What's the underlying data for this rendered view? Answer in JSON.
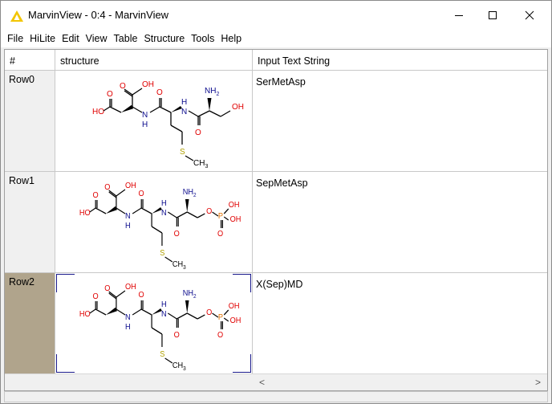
{
  "window": {
    "title": "MarvinView - 0:4 - MarvinView"
  },
  "menu": [
    "File",
    "HiLite",
    "Edit",
    "View",
    "Table",
    "Structure",
    "Tools",
    "Help"
  ],
  "columns": {
    "num": "#",
    "structure": "structure",
    "text": "Input Text String"
  },
  "rows": [
    {
      "id": "Row0",
      "text": "SerMetAsp",
      "selected": false,
      "phospho": false
    },
    {
      "id": "Row1",
      "text": "SepMetAsp",
      "selected": false,
      "phospho": true
    },
    {
      "id": "Row2",
      "text": "X(Sep)MD",
      "selected": true,
      "phospho": true
    }
  ],
  "atoms": {
    "oh": "OH",
    "ho": "HO",
    "nh": "NH",
    "h": "H",
    "n": "N",
    "o": "O",
    "nh2": "NH",
    "sub2": "2",
    "s": "S",
    "ch3": "CH",
    "sub3": "3",
    "p": "P"
  },
  "colors": {
    "selected_row": "#b0a48c",
    "oxygen": "#e00000",
    "nitrogen": "#0a0a8c",
    "sulfur": "#b0a000",
    "phosphorus": "#e07000",
    "selection_frame": "#1a1a8c"
  },
  "scroll": {
    "left": "<",
    "right": ">"
  }
}
